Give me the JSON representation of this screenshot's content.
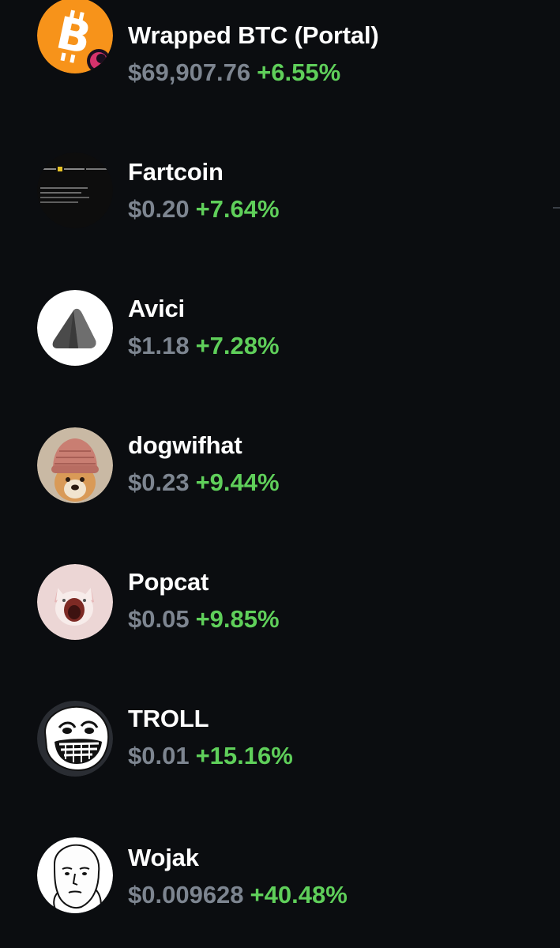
{
  "tokens": [
    {
      "name": "Wrapped BTC (Portal)",
      "price": "$69,907.76",
      "change": "+6.55%",
      "icon": "bitcoin-icon"
    },
    {
      "name": "Fartcoin",
      "price": "$0.20",
      "change": "+7.64%",
      "icon": "fartcoin-icon"
    },
    {
      "name": "Avici",
      "price": "$1.18",
      "change": "+7.28%",
      "icon": "avici-icon"
    },
    {
      "name": "dogwifhat",
      "price": "$0.23",
      "change": "+9.44%",
      "icon": "dogwifhat-icon"
    },
    {
      "name": "Popcat",
      "price": "$0.05",
      "change": "+9.85%",
      "icon": "popcat-icon"
    },
    {
      "name": "TROLL",
      "price": "$0.01",
      "change": "+15.16%",
      "icon": "trollface-icon"
    },
    {
      "name": "Wojak",
      "price": "$0.009628",
      "change": "+40.48%",
      "icon": "wojak-icon"
    }
  ],
  "colors": {
    "background": "#0b0d10",
    "name_text": "#ffffff",
    "price_text": "#7d8590",
    "positive_change": "#5fcf5a",
    "bitcoin_orange": "#f7931a"
  }
}
